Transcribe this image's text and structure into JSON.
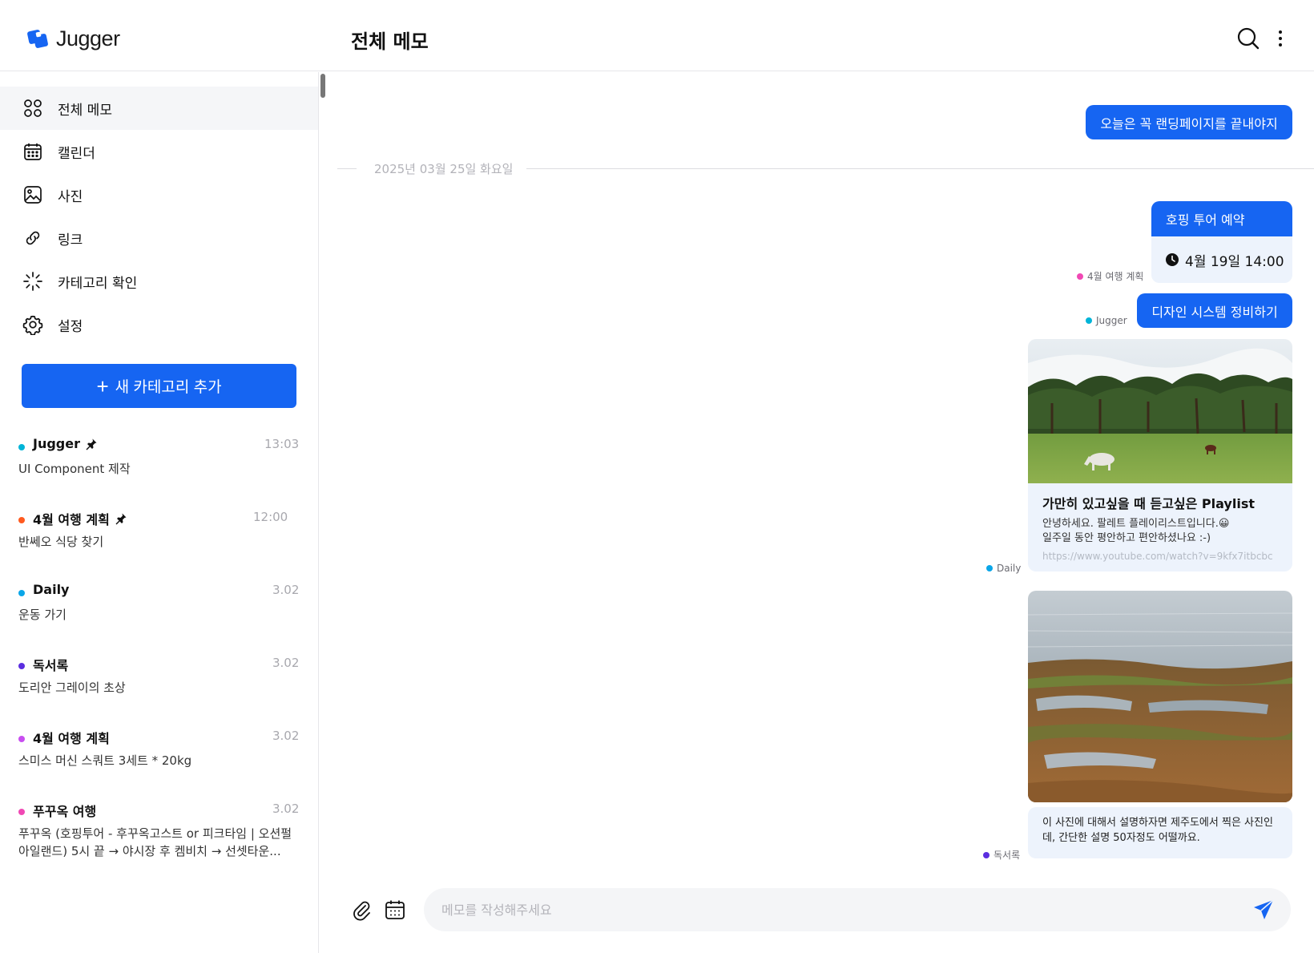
{
  "app": {
    "name": "Jugger",
    "brand_color": "#1665f2"
  },
  "header": {
    "title": "전체 메모"
  },
  "sidebar": {
    "nav": [
      {
        "label": "전체 메모",
        "icon": "grid-icon",
        "active": true
      },
      {
        "label": "캘린더",
        "icon": "calendar-icon"
      },
      {
        "label": "사진",
        "icon": "image-icon"
      },
      {
        "label": "링크",
        "icon": "link-icon"
      },
      {
        "label": "카테고리 확인",
        "icon": "loading-icon"
      },
      {
        "label": "설정",
        "icon": "gear-icon"
      }
    ],
    "add_button": {
      "plus": "+",
      "label": "새 카테고리 추가"
    },
    "memos": [
      {
        "title": "Jugger",
        "time": "13:03",
        "preview": "UI Component 제작",
        "color": "#00b4d8",
        "pinned": true
      },
      {
        "title": "4월 여행 계획",
        "time": "12:00",
        "preview": "반쎄오 식당 찾기",
        "color": "#ff5a1f",
        "pinned": true
      },
      {
        "title": "Daily",
        "time": "3.02",
        "preview": "운동 가기",
        "color": "#0aa6e8",
        "pinned": false
      },
      {
        "title": "독서록",
        "time": "3.02",
        "preview": "도리안 그레이의 초상",
        "color": "#5b2ee0",
        "pinned": false
      },
      {
        "title": "4월 여행 계획",
        "time": "3.02",
        "preview": "스미스 머신 스쿼트 3세트 * 20kg",
        "color": "#c84ef0",
        "pinned": false
      },
      {
        "title": "푸꾸옥 여행",
        "time": "3.02",
        "preview": "푸꾸옥 (호핑투어 - 후꾸옥고스트 or 피크타임 | 오션펄 아일랜드) 5시 끝 → 야시장 후 켐비치 → 선셋타운...",
        "color": "#f048b4",
        "pinned": false
      }
    ]
  },
  "main": {
    "messages": {
      "landing": "오늘은 꼭 랜딩페이지를 끝내야지",
      "date_divider": "2025년 03월 25일 화요일",
      "hopping": {
        "title": "호핑 투어 예약",
        "time": "4월 19일 14:00",
        "tag": "4월 여행 계획",
        "tag_color": "#f048b4"
      },
      "design": {
        "text": "디자인 시스템 정비하기",
        "tag": "Jugger",
        "tag_color": "#00b4d8"
      },
      "link_card": {
        "title": "가만히 있고싶을 때 듣고싶은 Playlist",
        "desc_1": "안녕하세요. 팔레트 플레이리스트입니다.😀",
        "desc_2": "일주일 동안 평안하고 편안하셨나요 :-)",
        "url": "https://www.youtube.com/watch?v=9kfx7itbcbc",
        "tag": "Daily",
        "tag_color": "#0aa6e8"
      },
      "photo_note": {
        "text": "이 사진에 대해서 설명하자면 제주도에서 찍은 사진인데, 간단한 설명 50자정도 어떨까요.",
        "tag": "독서록",
        "tag_color": "#5b2ee0"
      }
    },
    "composer": {
      "placeholder": "메모를 작성해주세요"
    }
  }
}
